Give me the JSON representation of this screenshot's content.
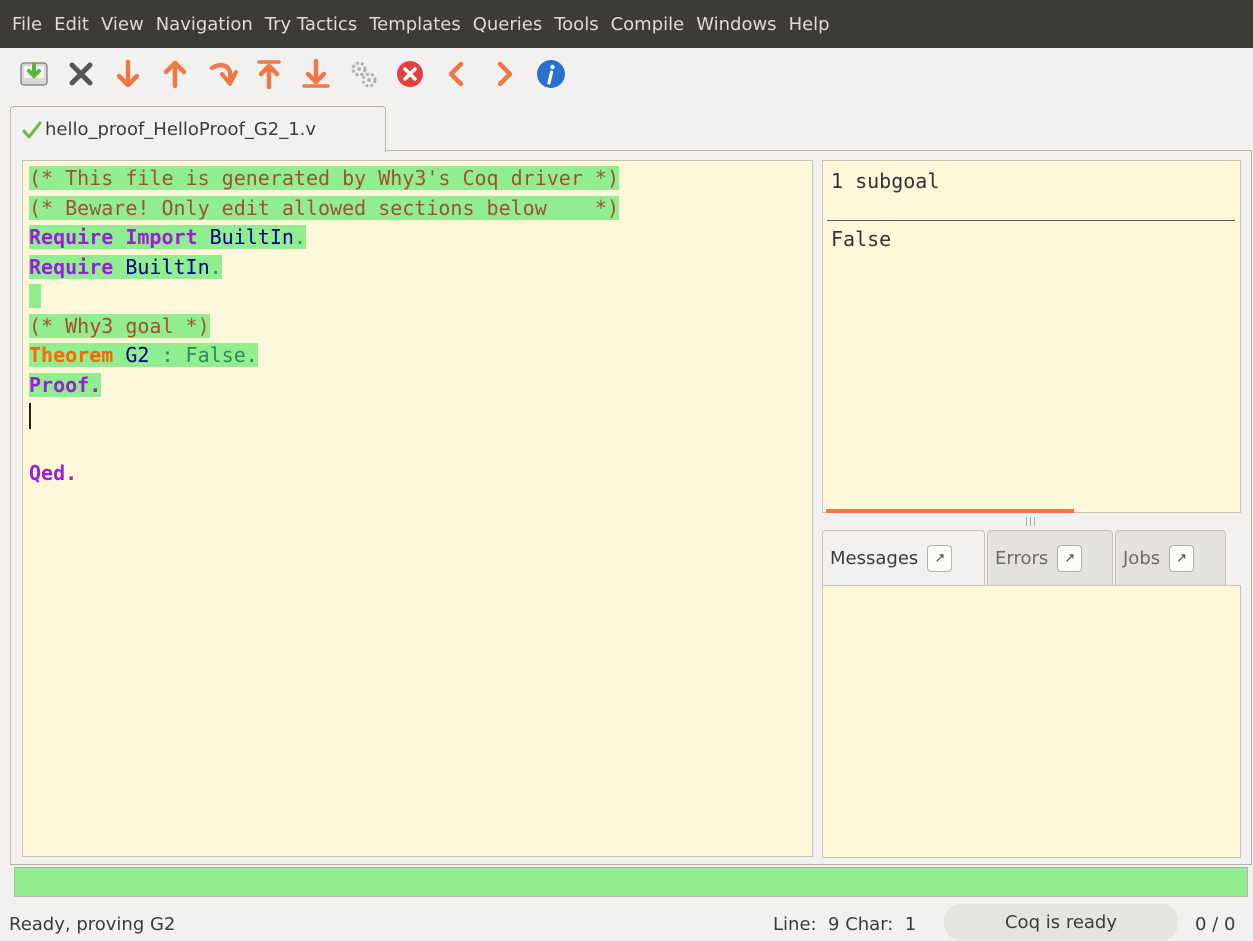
{
  "menubar": {
    "items": [
      "File",
      "Edit",
      "View",
      "Navigation",
      "Try Tactics",
      "Templates",
      "Queries",
      "Tools",
      "Compile",
      "Windows",
      "Help"
    ]
  },
  "toolbar": {
    "buttons": [
      {
        "name": "save-icon",
        "color": "#6fbf3f"
      },
      {
        "name": "close-icon",
        "color": "#555555"
      },
      {
        "name": "forward-one-icon",
        "color": "#f07746"
      },
      {
        "name": "backward-one-icon",
        "color": "#f07746"
      },
      {
        "name": "go-to-cursor-icon",
        "color": "#f07746"
      },
      {
        "name": "restart-icon",
        "color": "#f07746"
      },
      {
        "name": "end-icon",
        "color": "#f07746"
      },
      {
        "name": "fully-automatic-icon",
        "color": "#aaaaaa"
      },
      {
        "name": "interrupt-icon",
        "color": "#e04040"
      },
      {
        "name": "previous-occurrence-icon",
        "color": "#f07746"
      },
      {
        "name": "next-occurrence-icon",
        "color": "#f07746"
      },
      {
        "name": "about-icon",
        "color": "#2a6fc9"
      }
    ]
  },
  "tab": {
    "filename": "hello_proof_HelloProof_G2_1.v"
  },
  "script": {
    "line1": "(* This file is generated by Why3's Coq driver *)",
    "line2": "(* Beware! Only edit allowed sections below    *)",
    "line3_kw1": "Require",
    "line3_kw2": "Import",
    "line3_id": "BuiltIn",
    "line3_dot": ".",
    "line4_kw": "Require",
    "line4_id": "BuiltIn",
    "line4_dot": ".",
    "line6": "(* Why3 goal *)",
    "line7_kw": "Theorem",
    "line7_id": "G2",
    "line7_rest": " : False.",
    "line8": "Proof.",
    "line11": "Qed."
  },
  "goals": {
    "count": "1 subgoal",
    "conclusion": "False"
  },
  "messages": {
    "tabs": [
      {
        "label": "Messages",
        "detach": "↗"
      },
      {
        "label": "Errors",
        "detach": "↗"
      },
      {
        "label": "Jobs",
        "detach": "↗"
      }
    ]
  },
  "status": {
    "message": "Ready, proving G2",
    "line_char": "Line:  9 Char:  1",
    "coq_state": "Coq is ready",
    "counter": "0 / 0"
  },
  "colors": {
    "processed_highlight": "#90ee90",
    "editor_background": "#fff7d9",
    "keyword": "#9a1fd6",
    "theorem_keyword": "#ff6600",
    "comment": "#a0522d"
  }
}
